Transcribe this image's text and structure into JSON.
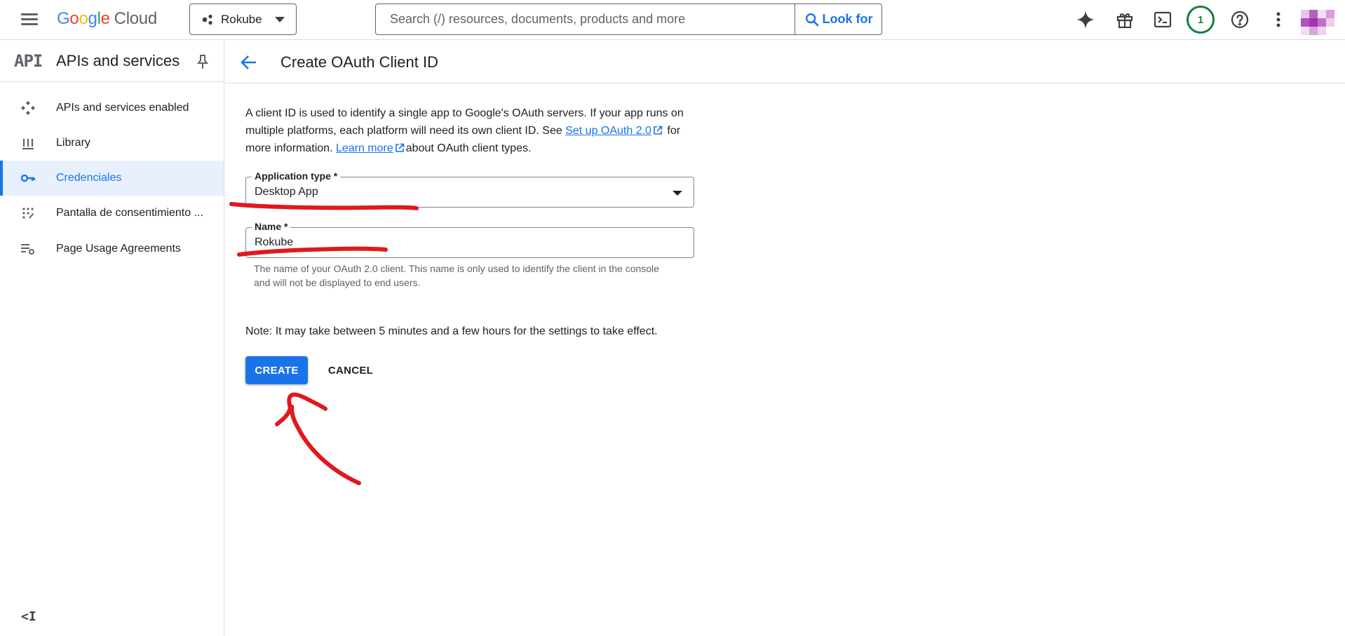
{
  "topbar": {
    "logo_letters": [
      "G",
      "o",
      "o",
      "g",
      "l",
      "e"
    ],
    "logo_suffix": "Cloud",
    "project_name": "Rokube",
    "search_placeholder": "Search (/) resources, documents, products and more",
    "search_button_label": "Look for",
    "notification_count": "1",
    "icons": [
      "menu-icon",
      "project-icon",
      "search-icon",
      "gemini-sparkle-icon",
      "gift-icon",
      "terminal-icon",
      "help-icon",
      "more-vert-icon",
      "account-avatar"
    ]
  },
  "sidebar": {
    "logo_text": "API",
    "title": "APIs and services",
    "items": [
      {
        "label": "APIs and services enabled",
        "icon": "apis-enabled-icon",
        "active": false
      },
      {
        "label": "Library",
        "icon": "library-icon",
        "active": false
      },
      {
        "label": "Credenciales",
        "icon": "key-icon",
        "active": true
      },
      {
        "label": "Pantalla de consentimiento ...",
        "icon": "consent-screen-icon",
        "active": false
      },
      {
        "label": "Page Usage Agreements",
        "icon": "usage-agreements-icon",
        "active": false
      }
    ],
    "collapse_label": "<I"
  },
  "main": {
    "title": "Create OAuth Client ID",
    "intro_part1": "A client ID is used to identify a single app to Google's OAuth servers. If your app runs on multiple platforms, each platform will need its own client ID. See ",
    "setup_link": "Set up OAuth 2.0",
    "intro_part2": " for more information. ",
    "learn_more_link": "Learn more",
    "intro_part3": "about OAuth client types.",
    "app_type_label": "Application type *",
    "app_type_value": "Desktop App",
    "name_label": "Name *",
    "name_value": "Rokube",
    "name_hint": "The name of your OAuth 2.0 client. This name is only used to identify the client in the console and will not be displayed to end users.",
    "note": "Note: It may take between 5 minutes and a few hours for the settings to take effect.",
    "create_label": "CREATE",
    "cancel_label": "CANCEL"
  },
  "colors": {
    "accent": "#1a73e8",
    "active_bg": "#e8f0fe",
    "annotation_red": "#e0191d",
    "badge_green": "#188038"
  }
}
